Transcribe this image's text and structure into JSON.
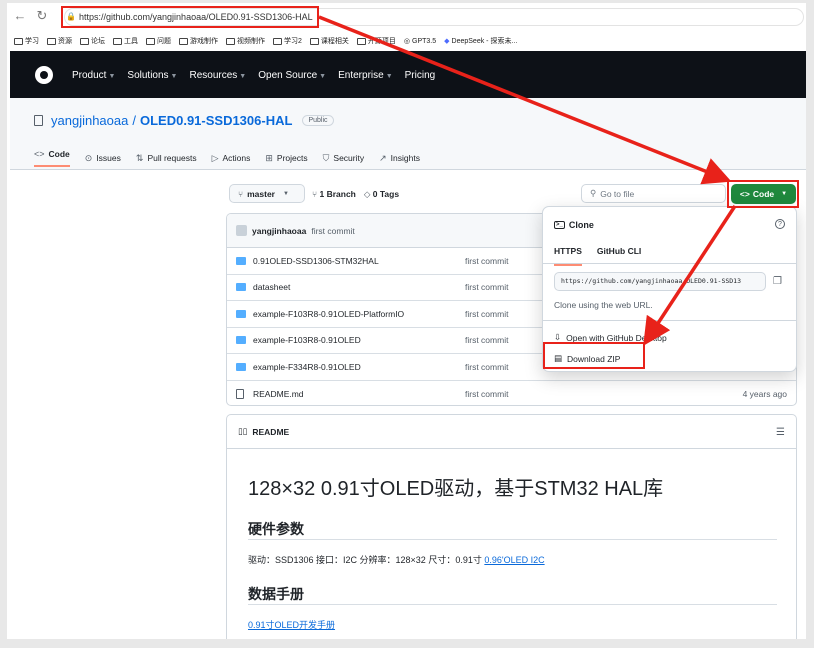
{
  "browser": {
    "url": "https://github.com/yangjinhaoaa/OLED0.91-SSD1306-HAL",
    "bookmarks": [
      "学习",
      "资源",
      "论坛",
      "工具",
      "问题",
      "游戏制作",
      "视频制作",
      "学习2",
      "课程相关",
      "开源项目",
      "GPT3.5",
      "DeepSeek - 探索未..."
    ]
  },
  "gh_nav": [
    "Product",
    "Solutions",
    "Resources",
    "Open Source",
    "Enterprise",
    "Pricing"
  ],
  "repo": {
    "owner": "yangjinhaoaa",
    "name": "OLED0.91-SSD1306-HAL",
    "visibility": "Public",
    "tabs": [
      "Code",
      "Issues",
      "Pull requests",
      "Actions",
      "Projects",
      "Security",
      "Insights"
    ]
  },
  "toolbar": {
    "branch": "master",
    "branches": "1 Branch",
    "tags": "0 Tags",
    "goto_placeholder": "Go to file",
    "code_label": "Code"
  },
  "commit": {
    "author": "yangjinhaoaa",
    "message": "first commit"
  },
  "files": [
    {
      "name": "0.91OLED-SSD1306-STM32HAL",
      "commit": "first commit",
      "time": "",
      "type": "dir"
    },
    {
      "name": "datasheet",
      "commit": "first commit",
      "time": "",
      "type": "dir"
    },
    {
      "name": "example-F103R8-0.91OLED-PlatformIO",
      "commit": "first commit",
      "time": "",
      "type": "dir"
    },
    {
      "name": "example-F103R8-0.91OLED",
      "commit": "first commit",
      "time": "",
      "type": "dir"
    },
    {
      "name": "example-F334R8-0.91OLED",
      "commit": "first commit",
      "time": "",
      "type": "dir"
    },
    {
      "name": "README.md",
      "commit": "first commit",
      "time": "4 years ago",
      "type": "file"
    }
  ],
  "dropdown": {
    "title": "Clone",
    "tabs": [
      "HTTPS",
      "GitHub CLI"
    ],
    "clone_url": "https://github.com/yangjinhaoaa/OLED0.91-SSD13",
    "hint": "Clone using the web URL.",
    "open_desktop": "Open with GitHub Desktop",
    "download_zip": "Download ZIP"
  },
  "readme": {
    "tab": "README",
    "h1": "128×32 0.91寸OLED驱动，基于STM32 HAL库",
    "h2a": "硬件参数",
    "para": "驱动：SSD1306 接口：I2C 分辨率：128×32 尺寸：0.91寸",
    "para_link": "0.96'OLED I2C",
    "h2b": "数据手册",
    "manual_link": "0.91寸OLED开发手册"
  },
  "colors": {
    "annotation_red": "#e8221a",
    "code_green": "#1f883d",
    "header_dark": "#0d1117",
    "link_blue": "#0969da"
  }
}
